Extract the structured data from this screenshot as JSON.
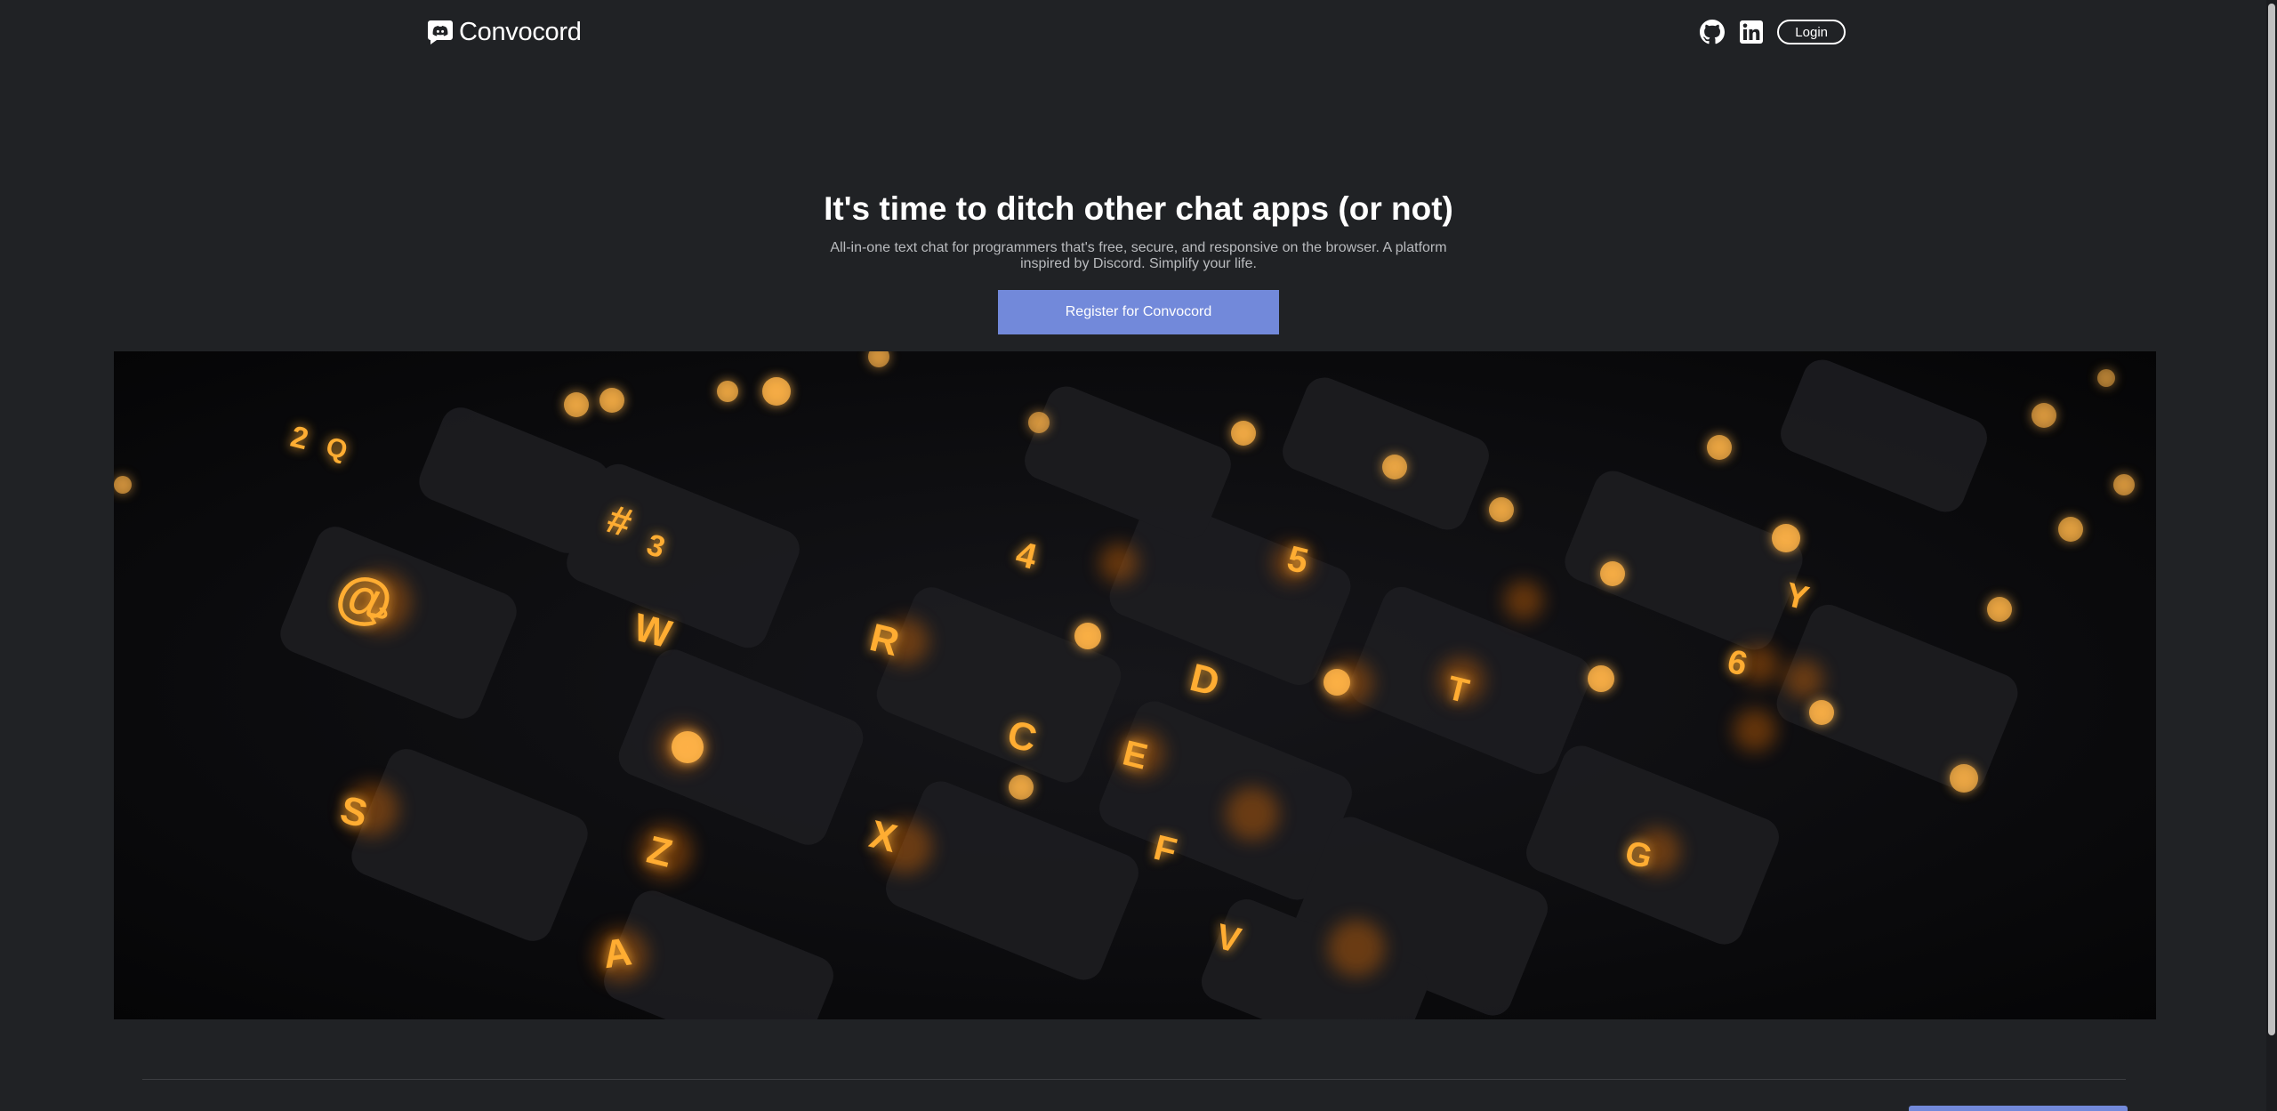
{
  "header": {
    "brand_name": "Convocord",
    "brand_icon": "discord-chat-bubble-icon",
    "github_icon": "github-icon",
    "linkedin_icon": "linkedin-icon",
    "login_label": "Login"
  },
  "hero": {
    "title": "It's time to ditch other chat apps (or not)",
    "subtitle": "All-in-one text chat for programmers that's free, secure, and responsive on the browser. A platform inspired by Discord. Simplify your life.",
    "register_label": "Register for Convocord",
    "image": "backlit-keyboard-photo"
  },
  "colors": {
    "background": "#202225",
    "accent": "#7289da",
    "key_glow": "#ff9a1a"
  }
}
